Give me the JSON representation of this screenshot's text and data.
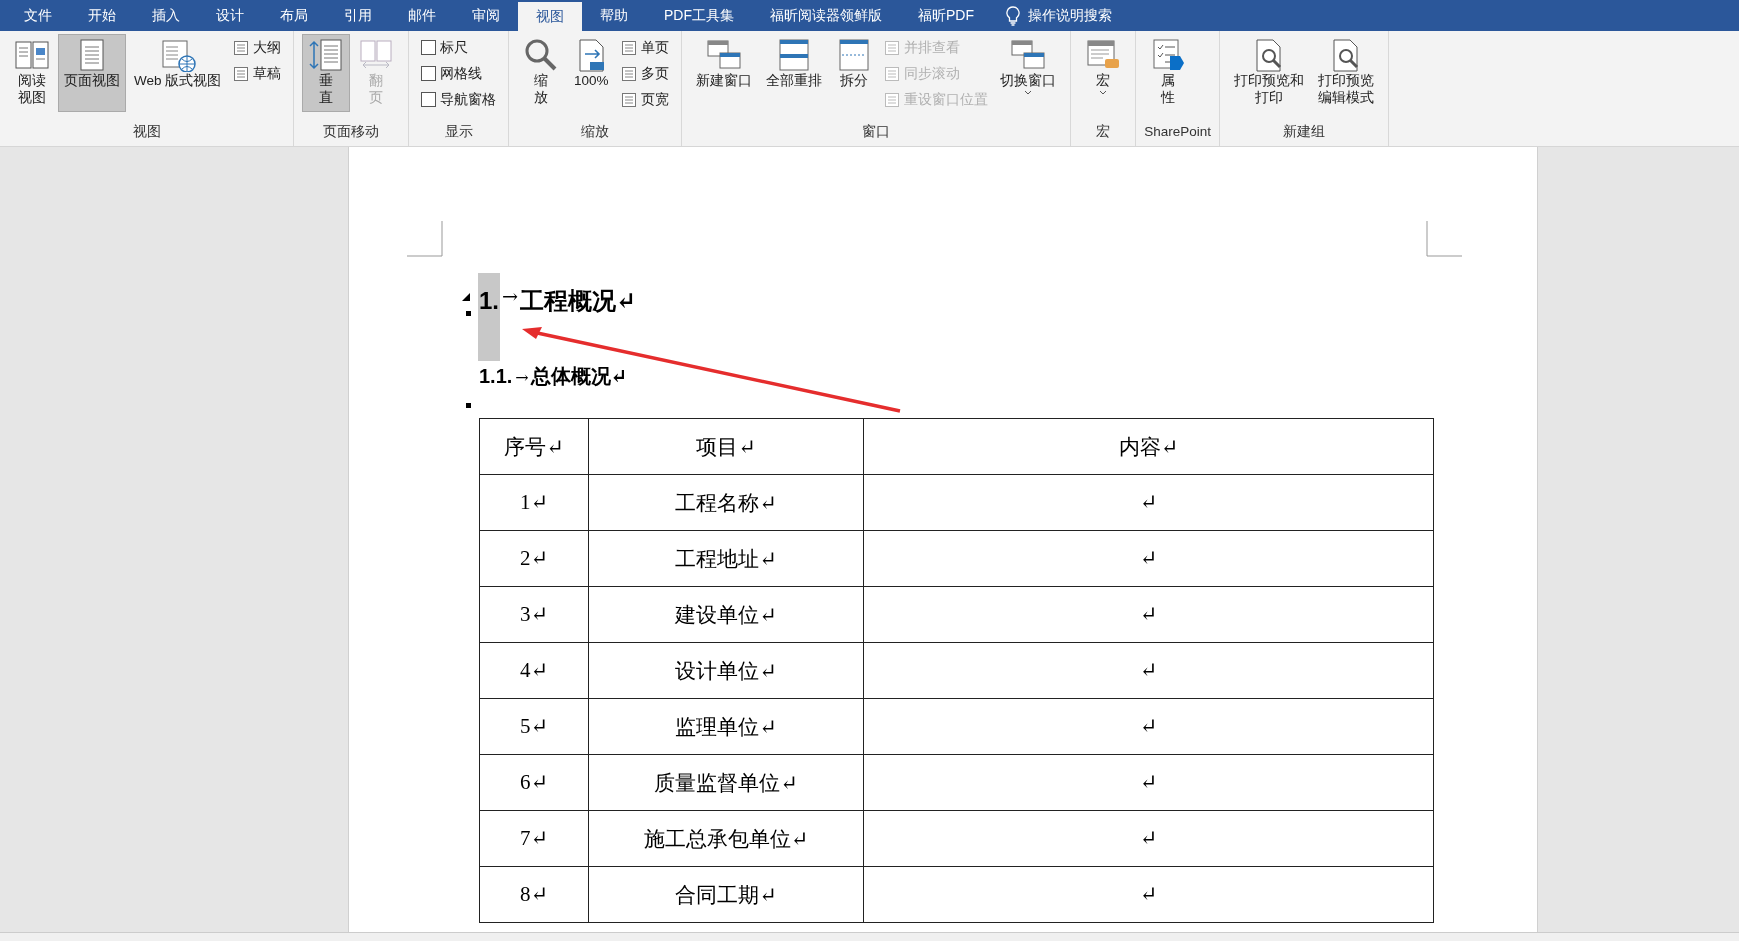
{
  "tabs": [
    {
      "label": "文件",
      "selected": false
    },
    {
      "label": "开始",
      "selected": false
    },
    {
      "label": "插入",
      "selected": false
    },
    {
      "label": "设计",
      "selected": false
    },
    {
      "label": "布局",
      "selected": false
    },
    {
      "label": "引用",
      "selected": false
    },
    {
      "label": "邮件",
      "selected": false
    },
    {
      "label": "审阅",
      "selected": false
    },
    {
      "label": "视图",
      "selected": true
    },
    {
      "label": "帮助",
      "selected": false
    },
    {
      "label": "PDF工具集",
      "selected": false
    },
    {
      "label": "福昕阅读器领鲜版",
      "selected": false
    },
    {
      "label": "福昕PDF",
      "selected": false
    }
  ],
  "tell_me": "操作说明搜索",
  "ribbon": [
    {
      "label": "视图",
      "items": [
        {
          "kind": "large",
          "lines": [
            "阅读",
            "视图"
          ],
          "selected": false,
          "disabled": false
        },
        {
          "kind": "large",
          "lines": [
            "页面视图"
          ],
          "selected": true,
          "disabled": false
        },
        {
          "kind": "large",
          "lines": [
            "Web 版式视图"
          ],
          "selected": false,
          "disabled": false
        },
        {
          "kind": "small",
          "label": "大纲",
          "disabled": false
        },
        {
          "kind": "small",
          "label": "草稿",
          "disabled": false
        }
      ]
    },
    {
      "label": "页面移动",
      "items": [
        {
          "kind": "large",
          "lines": [
            "垂",
            "直"
          ],
          "selected": true,
          "disabled": false
        },
        {
          "kind": "large",
          "lines": [
            "翻",
            "页"
          ],
          "selected": false,
          "disabled": true
        }
      ]
    },
    {
      "label": "显示",
      "items": [
        {
          "kind": "check",
          "label": "标尺",
          "checked": false
        },
        {
          "kind": "check",
          "label": "网格线",
          "checked": false
        },
        {
          "kind": "check",
          "label": "导航窗格",
          "checked": false
        }
      ]
    },
    {
      "label": "缩放",
      "items": [
        {
          "kind": "large",
          "lines": [
            "缩",
            "放"
          ],
          "selected": false,
          "disabled": false
        },
        {
          "kind": "large",
          "lines": [
            "100%"
          ],
          "selected": false,
          "disabled": false
        },
        {
          "kind": "small",
          "label": "单页",
          "disabled": false
        },
        {
          "kind": "small",
          "label": "多页",
          "disabled": false
        },
        {
          "kind": "small",
          "label": "页宽",
          "disabled": false
        }
      ]
    },
    {
      "label": "窗口",
      "items": [
        {
          "kind": "large",
          "lines": [
            "新建窗口"
          ],
          "selected": false,
          "disabled": false
        },
        {
          "kind": "large",
          "lines": [
            "全部重排"
          ],
          "selected": false,
          "disabled": false
        },
        {
          "kind": "large",
          "lines": [
            "拆分"
          ],
          "selected": false,
          "disabled": false
        },
        {
          "kind": "small",
          "label": "并排查看",
          "disabled": true
        },
        {
          "kind": "small",
          "label": "同步滚动",
          "disabled": true
        },
        {
          "kind": "small",
          "label": "重设窗口位置",
          "disabled": true
        },
        {
          "kind": "large",
          "lines": [
            "切换窗口"
          ],
          "selected": false,
          "disabled": false,
          "dropdown": true
        }
      ]
    },
    {
      "label": "宏",
      "items": [
        {
          "kind": "large",
          "lines": [
            "宏"
          ],
          "selected": false,
          "disabled": false,
          "dropdown": true
        }
      ]
    },
    {
      "label": "SharePoint",
      "items": [
        {
          "kind": "large",
          "lines": [
            "属",
            "性"
          ],
          "selected": false,
          "disabled": false
        }
      ]
    },
    {
      "label": "新建组",
      "items": [
        {
          "kind": "large",
          "lines": [
            "打印预览和",
            "打印"
          ],
          "selected": false,
          "disabled": false
        },
        {
          "kind": "large",
          "lines": [
            "打印预览",
            "编辑模式"
          ],
          "selected": false,
          "disabled": false
        }
      ]
    }
  ],
  "document": {
    "heading1": {
      "number": "1.",
      "tab": "→",
      "text": "工程概况↵",
      "selected": true
    },
    "heading2": {
      "number": "1.1.",
      "tab": "→",
      "text": "总体概况↵"
    },
    "table": {
      "columns": [
        "序号↵",
        "项目↵",
        "内容↵"
      ],
      "rows": [
        [
          "1↵",
          "工程名称↵",
          "↵"
        ],
        [
          "2↵",
          "工程地址↵",
          "↵"
        ],
        [
          "3↵",
          "建设单位↵",
          "↵"
        ],
        [
          "4↵",
          "设计单位↵",
          "↵"
        ],
        [
          "5↵",
          "监理单位↵",
          "↵"
        ],
        [
          "6↵",
          "质量监督单位↵",
          "↵"
        ],
        [
          "7↵",
          "施工总承包单位↵",
          "↵"
        ],
        [
          "8↵",
          "合同工期↵",
          "↵"
        ]
      ]
    }
  }
}
